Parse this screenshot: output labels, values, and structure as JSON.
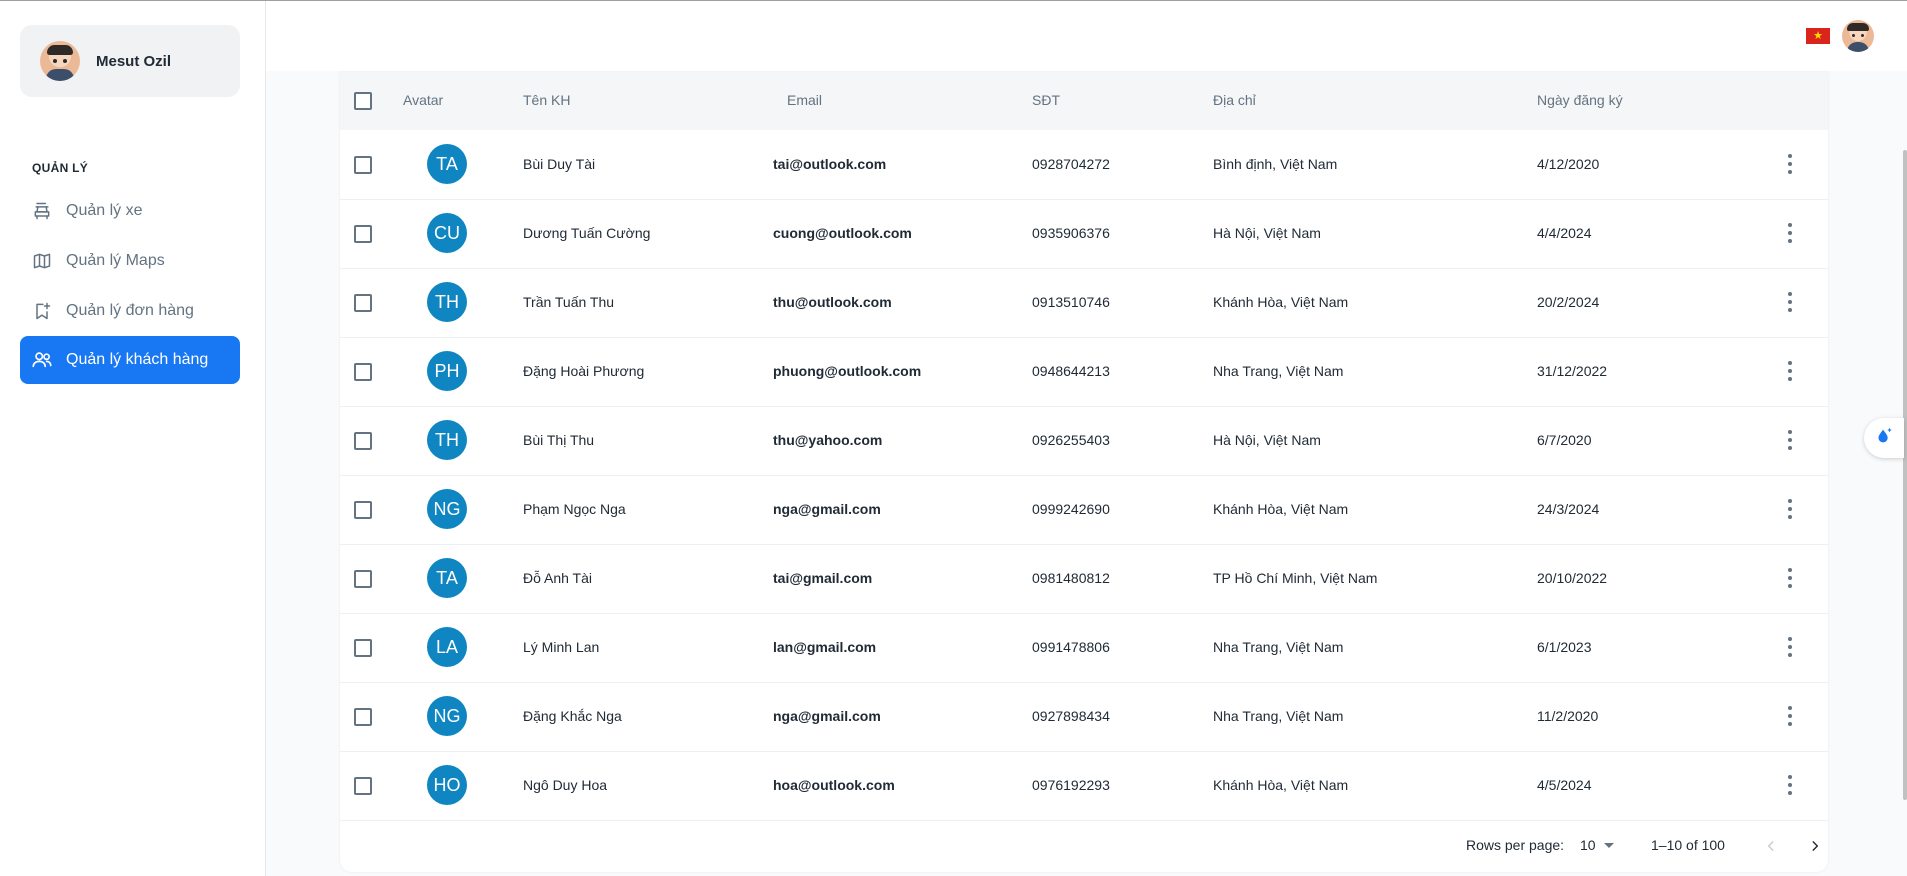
{
  "sidebar": {
    "user_name": "Mesut Ozil",
    "section_title": "QUẢN LÝ",
    "items": [
      {
        "label": "Quản lý xe",
        "icon": "car-icon",
        "active": false
      },
      {
        "label": "Quản lý Maps",
        "icon": "map-icon",
        "active": false
      },
      {
        "label": "Quản lý đơn hàng",
        "icon": "order-icon",
        "active": false
      },
      {
        "label": "Quản lý khách hàng",
        "icon": "users-icon",
        "active": true
      }
    ],
    "active_color": "#1877f2"
  },
  "header": {
    "flag_icon": "vietnam-flag-icon",
    "flag_star": "★"
  },
  "table": {
    "columns": [
      "Avatar",
      "Tên KH",
      "Email",
      "SĐT",
      "Địa chỉ",
      "Ngày đăng ký"
    ],
    "rows": [
      {
        "initials": "TA",
        "name": "Bùi Duy Tài",
        "email": "tai@outlook.com",
        "phone": "0928704272",
        "address": "Bình định, Việt Nam",
        "date": "4/12/2020"
      },
      {
        "initials": "CU",
        "name": "Dương Tuấn Cường",
        "email": "cuong@outlook.com",
        "phone": "0935906376",
        "address": "Hà Nội, Việt Nam",
        "date": "4/4/2024"
      },
      {
        "initials": "TH",
        "name": "Trần Tuấn Thu",
        "email": "thu@outlook.com",
        "phone": "0913510746",
        "address": "Khánh Hòa, Việt Nam",
        "date": "20/2/2024"
      },
      {
        "initials": "PH",
        "name": "Đặng Hoài Phương",
        "email": "phuong@outlook.com",
        "phone": "0948644213",
        "address": "Nha Trang, Việt Nam",
        "date": "31/12/2022"
      },
      {
        "initials": "TH",
        "name": "Bùi Thị Thu",
        "email": "thu@yahoo.com",
        "phone": "0926255403",
        "address": "Hà Nội, Việt Nam",
        "date": "6/7/2020"
      },
      {
        "initials": "NG",
        "name": "Phạm Ngọc Nga",
        "email": "nga@gmail.com",
        "phone": "0999242690",
        "address": "Khánh Hòa, Việt Nam",
        "date": "24/3/2024"
      },
      {
        "initials": "TA",
        "name": "Đỗ Anh Tài",
        "email": "tai@gmail.com",
        "phone": "0981480812",
        "address": "TP Hồ Chí Minh, Việt Nam",
        "date": "20/10/2022"
      },
      {
        "initials": "LA",
        "name": "Lý Minh Lan",
        "email": "lan@gmail.com",
        "phone": "0991478806",
        "address": "Nha Trang, Việt Nam",
        "date": "6/1/2023"
      },
      {
        "initials": "NG",
        "name": "Đặng Khắc Nga",
        "email": "nga@gmail.com",
        "phone": "0927898434",
        "address": "Nha Trang, Việt Nam",
        "date": "11/2/2020"
      },
      {
        "initials": "HO",
        "name": "Ngô Duy Hoa",
        "email": "hoa@outlook.com",
        "phone": "0976192293",
        "address": "Khánh Hòa, Việt Nam",
        "date": "4/5/2024"
      }
    ],
    "avatar_color": "#0f86c2"
  },
  "pagination": {
    "rows_per_page_label": "Rows per page:",
    "rows_per_page_value": "10",
    "range_text": "1–10 of 100"
  }
}
